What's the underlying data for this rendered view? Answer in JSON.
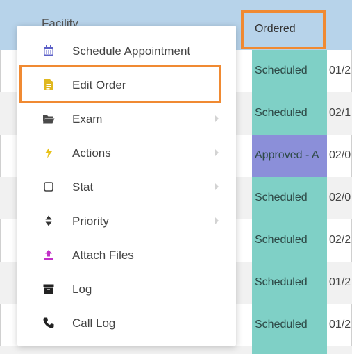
{
  "table": {
    "header_facility": "Facility",
    "header_ordered": "Ordered",
    "rows": [
      {
        "status": "Scheduled",
        "date": "01/2"
      },
      {
        "status": "Scheduled",
        "date": "02/1"
      },
      {
        "status": "Approved - A",
        "date": "02/0"
      },
      {
        "status": "Scheduled",
        "date": "02/0"
      },
      {
        "status": "Scheduled",
        "date": "02/2"
      },
      {
        "status": "Scheduled",
        "date": "01/2"
      },
      {
        "status": "Scheduled",
        "date": "01/2"
      }
    ]
  },
  "menu": {
    "items": [
      {
        "label": "Schedule Appointment",
        "icon": "calendar-icon",
        "submenu": false
      },
      {
        "label": "Edit Order",
        "icon": "document-icon",
        "submenu": false
      },
      {
        "label": "Exam",
        "icon": "folder-open-icon",
        "submenu": true
      },
      {
        "label": "Actions",
        "icon": "lightning-icon",
        "submenu": true
      },
      {
        "label": "Stat",
        "icon": "checkbox-icon",
        "submenu": true
      },
      {
        "label": "Priority",
        "icon": "sort-icon",
        "submenu": true
      },
      {
        "label": "Attach Files",
        "icon": "upload-icon",
        "submenu": false
      },
      {
        "label": "Log",
        "icon": "archive-icon",
        "submenu": false
      },
      {
        "label": "Call Log",
        "icon": "phone-icon",
        "submenu": false
      }
    ]
  },
  "colors": {
    "header_bg": "#b7d3ea",
    "scheduled": "#7fd0c6",
    "approved": "#8b8fd9",
    "highlight": "#f08a32"
  }
}
